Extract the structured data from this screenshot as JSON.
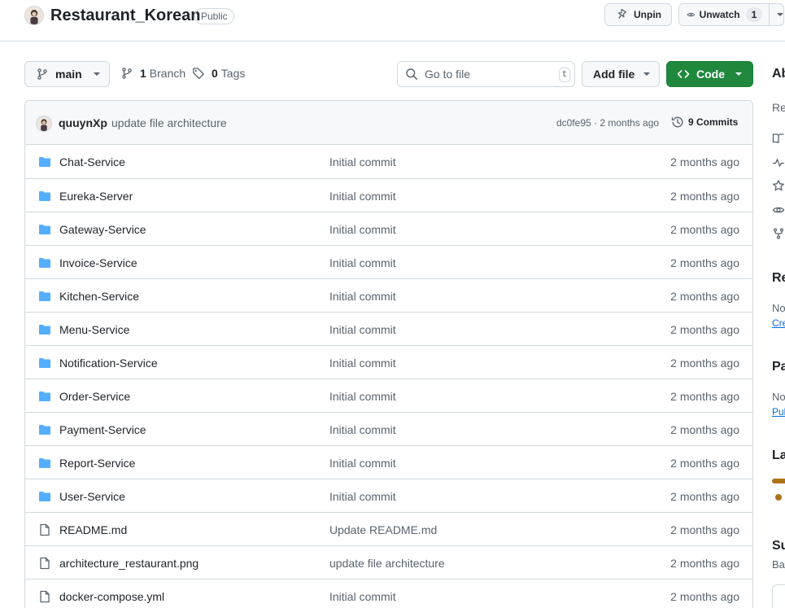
{
  "repo": {
    "name": "Restaurant_Korean",
    "visibility": "Public",
    "unpin_label": "Unpin",
    "unwatch_label": "Unwatch",
    "watchers": "1"
  },
  "toolbar": {
    "branch": "main",
    "branch_count": "1",
    "branch_label": "Branch",
    "tag_count": "0",
    "tag_label": "Tags",
    "goto_placeholder": "Go to file",
    "goto_shortcut": "t",
    "add_file_label": "Add file",
    "code_label": "Code"
  },
  "latest_commit": {
    "author": "quuynXp",
    "message": "update file architecture",
    "sha_age": "dc0fe95 · 2 months ago",
    "commits_label": "9 Commits"
  },
  "files": [
    {
      "type": "dir",
      "name": "Chat-Service",
      "commit": "Initial commit",
      "age": "2 months ago"
    },
    {
      "type": "dir",
      "name": "Eureka-Server",
      "commit": "Initial commit",
      "age": "2 months ago"
    },
    {
      "type": "dir",
      "name": "Gateway-Service",
      "commit": "Initial commit",
      "age": "2 months ago"
    },
    {
      "type": "dir",
      "name": "Invoice-Service",
      "commit": "Initial commit",
      "age": "2 months ago"
    },
    {
      "type": "dir",
      "name": "Kitchen-Service",
      "commit": "Initial commit",
      "age": "2 months ago"
    },
    {
      "type": "dir",
      "name": "Menu-Service",
      "commit": "Initial commit",
      "age": "2 months ago"
    },
    {
      "type": "dir",
      "name": "Notification-Service",
      "commit": "Initial commit",
      "age": "2 months ago"
    },
    {
      "type": "dir",
      "name": "Order-Service",
      "commit": "Initial commit",
      "age": "2 months ago"
    },
    {
      "type": "dir",
      "name": "Payment-Service",
      "commit": "Initial commit",
      "age": "2 months ago"
    },
    {
      "type": "dir",
      "name": "Report-Service",
      "commit": "Initial commit",
      "age": "2 months ago"
    },
    {
      "type": "dir",
      "name": "User-Service",
      "commit": "Initial commit",
      "age": "2 months ago"
    },
    {
      "type": "file",
      "name": "README.md",
      "commit": "Update README.md",
      "age": "2 months ago"
    },
    {
      "type": "file",
      "name": "architecture_restaurant.png",
      "commit": "update file architecture",
      "age": "2 months ago"
    },
    {
      "type": "file",
      "name": "docker-compose.yml",
      "commit": "Initial commit",
      "age": "2 months ago"
    }
  ],
  "sidebar_clipped": {
    "about_heading": "Ab",
    "about_desc": "Re",
    "releases_heading": "Re",
    "releases_text": "No",
    "releases_link": "Cre",
    "packages_heading": "Pa",
    "packages_text": "No",
    "packages_link": "Pul",
    "languages_heading": "La",
    "suggested_heading": "Su",
    "suggested_text": "Ba"
  },
  "colors": {
    "folder": "#54aeff",
    "code_button": "#1f883d",
    "link": "#0969da",
    "language_java": "#b07219"
  }
}
